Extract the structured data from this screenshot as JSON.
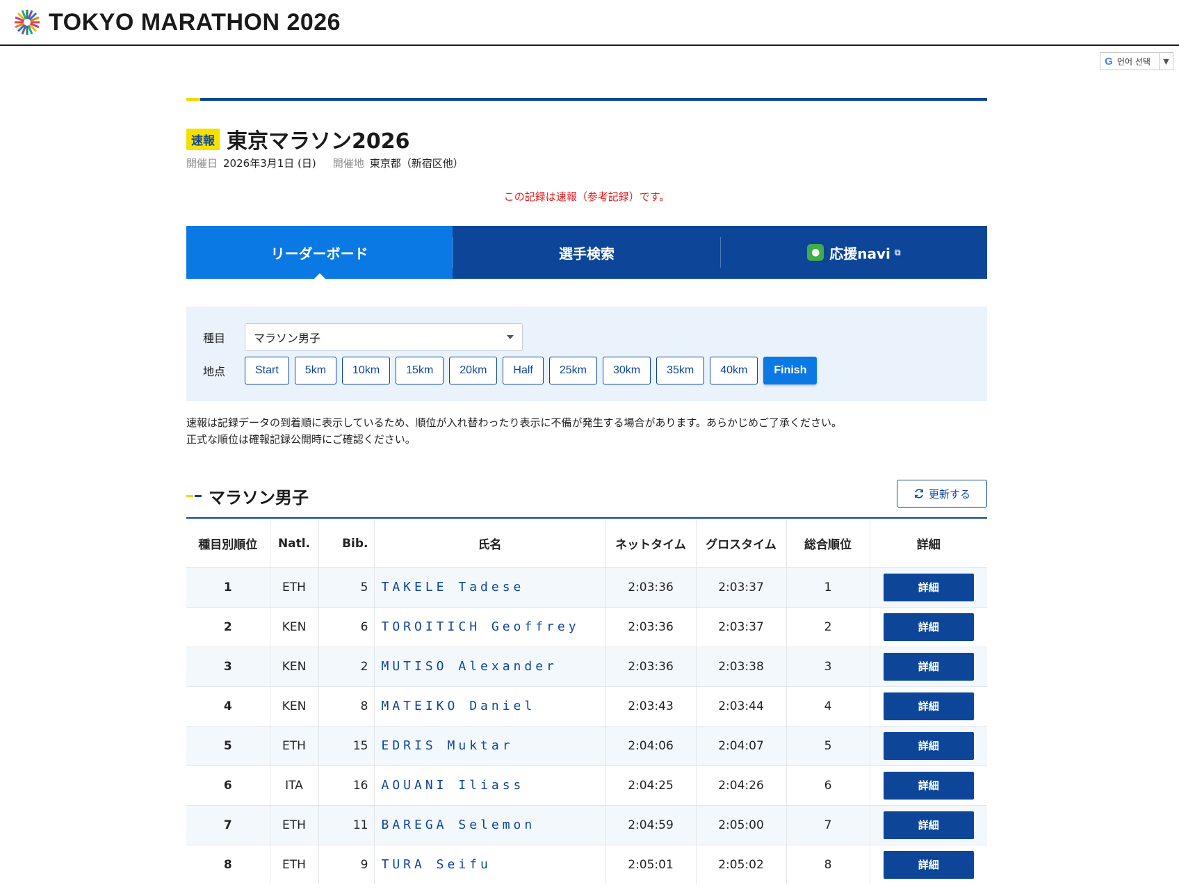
{
  "header": {
    "logo_text": "TOKYO MARATHON 2026"
  },
  "lang_widget": {
    "label": "언어 선택",
    "g_letter": "G",
    "arrow": "▼"
  },
  "page": {
    "badge": "速報",
    "title": "東京マラソン2026",
    "date_label": "開催日",
    "date_value": "2026年3月1日 (日)",
    "venue_label": "開催地",
    "venue_value": "東京都（新宿区他）",
    "notice": "この記録は速報（参考記録）です。"
  },
  "tabs": [
    {
      "label": "リーダーボード",
      "active": true
    },
    {
      "label": "選手検索",
      "active": false
    },
    {
      "label": "応援navi",
      "active": false
    }
  ],
  "filter": {
    "event_label": "種目",
    "event_value": "マラソン男子",
    "point_label": "地点",
    "points": [
      "Start",
      "5km",
      "10km",
      "15km",
      "20km",
      "Half",
      "25km",
      "30km",
      "35km",
      "40km",
      "Finish"
    ],
    "active_point": "Finish"
  },
  "disclaimer": {
    "line1": "速報は記録データの到着順に表示しているため、順位が入れ替わったり表示に不備が発生する場合があります。あらかじめご了承ください。",
    "line2": "正式な順位は確報記録公開時にご確認ください。"
  },
  "section": {
    "title": "マラソン男子",
    "refresh_label": "更新する"
  },
  "table": {
    "headers": [
      "種目別順位",
      "Natl.",
      "Bib.",
      "氏名",
      "ネットタイム",
      "グロスタイム",
      "総合順位",
      "詳細"
    ],
    "detail_label": "詳細",
    "rows": [
      {
        "rank": "1",
        "natl": "ETH",
        "bib": "5",
        "name": "TAKELE Tadese",
        "net": "2:03:36",
        "gross": "2:03:37",
        "overall": "1"
      },
      {
        "rank": "2",
        "natl": "KEN",
        "bib": "6",
        "name": "TOROITICH Geoffrey",
        "net": "2:03:36",
        "gross": "2:03:37",
        "overall": "2"
      },
      {
        "rank": "3",
        "natl": "KEN",
        "bib": "2",
        "name": "MUTISO Alexander",
        "net": "2:03:36",
        "gross": "2:03:38",
        "overall": "3"
      },
      {
        "rank": "4",
        "natl": "KEN",
        "bib": "8",
        "name": "MATEIKO Daniel",
        "net": "2:03:43",
        "gross": "2:03:44",
        "overall": "4"
      },
      {
        "rank": "5",
        "natl": "ETH",
        "bib": "15",
        "name": "EDRIS Muktar",
        "net": "2:04:06",
        "gross": "2:04:07",
        "overall": "5"
      },
      {
        "rank": "6",
        "natl": "ITA",
        "bib": "16",
        "name": "AOUANI Iliass",
        "net": "2:04:25",
        "gross": "2:04:26",
        "overall": "6"
      },
      {
        "rank": "7",
        "natl": "ETH",
        "bib": "11",
        "name": "BAREGA Selemon",
        "net": "2:04:59",
        "gross": "2:05:00",
        "overall": "7"
      },
      {
        "rank": "8",
        "natl": "ETH",
        "bib": "9",
        "name": "TURA Seifu",
        "net": "2:05:01",
        "gross": "2:05:02",
        "overall": "8"
      }
    ]
  },
  "colors": {
    "brand_navy": "#0d4699",
    "brand_blue": "#0b79e3",
    "badge_yellow": "#f5e100",
    "notice_red": "#e01a1a",
    "filter_bg": "#eaf3fc"
  }
}
